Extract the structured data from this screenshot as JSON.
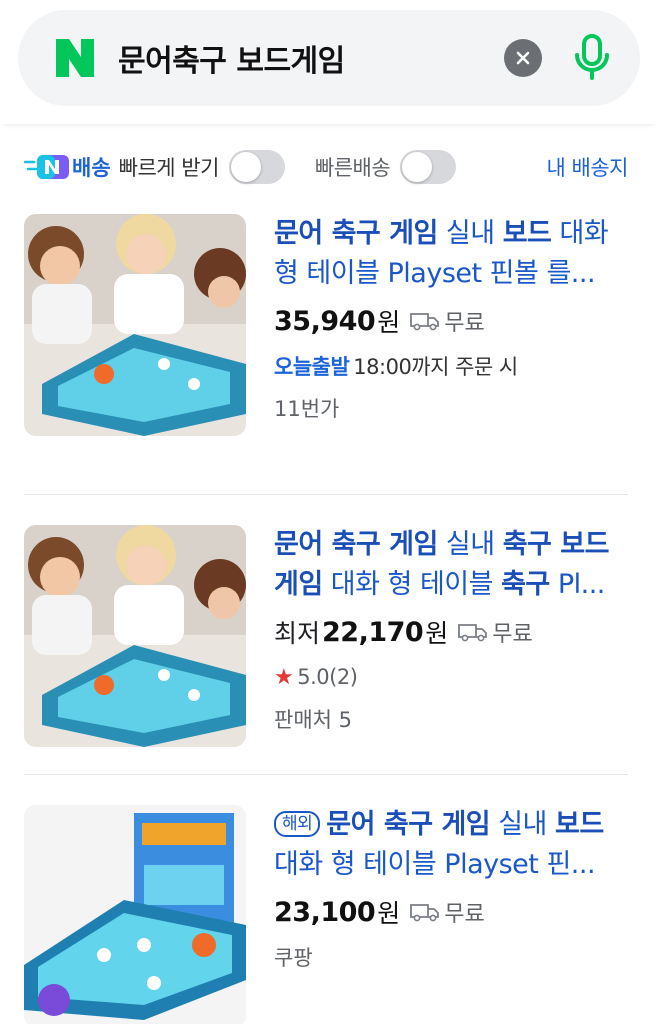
{
  "search": {
    "query": "문어축구 보드게임"
  },
  "filters": {
    "fast_label": "배송",
    "fast_receive": "빠르게 받기",
    "fast_delivery": "빠른배송",
    "my_shipping": "내 배송지"
  },
  "products": [
    {
      "title_parts": [
        {
          "text": "문어 축구 게임",
          "bold": true
        },
        {
          "text": " 실내 ",
          "bold": false
        },
        {
          "text": "보드",
          "bold": true
        },
        {
          "text": " 대화 형 테이블 Playset 핀볼 를...",
          "bold": false
        }
      ],
      "price_prefix": "",
      "price": "35,940",
      "currency": "원",
      "shipping": "무료",
      "delivery_badge": "오늘출발",
      "delivery_text": "18:00까지 주문 시",
      "seller": "11번가"
    },
    {
      "title_parts": [
        {
          "text": "문어 축구 게임",
          "bold": true
        },
        {
          "text": " 실내 ",
          "bold": false
        },
        {
          "text": "축구 보드",
          "bold": true
        },
        {
          "text": " ",
          "bold": false
        },
        {
          "text": "게임",
          "bold": true
        },
        {
          "text": " 대화 형 테이블 ",
          "bold": false
        },
        {
          "text": "축구",
          "bold": true
        },
        {
          "text": " Pl...",
          "bold": false
        }
      ],
      "price_prefix": "최저",
      "price": "22,170",
      "currency": "원",
      "shipping": "무료",
      "rating": "5.0",
      "review_count": "(2)",
      "seller": "판매처 5"
    },
    {
      "overseas_badge": "해외",
      "title_parts": [
        {
          "text": "문어 축구 게임",
          "bold": true
        },
        {
          "text": " 실내 ",
          "bold": false
        },
        {
          "text": "보드",
          "bold": true
        },
        {
          "text": " 대화 형 테이블 Playset 핀...",
          "bold": false
        }
      ],
      "price_prefix": "",
      "price": "23,100",
      "currency": "원",
      "shipping": "무료",
      "seller": "쿠팡"
    }
  ],
  "colors": {
    "naver_green": "#03c75a",
    "link_blue": "#1a57c7",
    "star_red": "#e53935"
  },
  "icons": [
    "naver-logo-icon",
    "clear-icon",
    "microphone-icon",
    "naver-delivery-icon",
    "truck-icon",
    "star-icon"
  ]
}
